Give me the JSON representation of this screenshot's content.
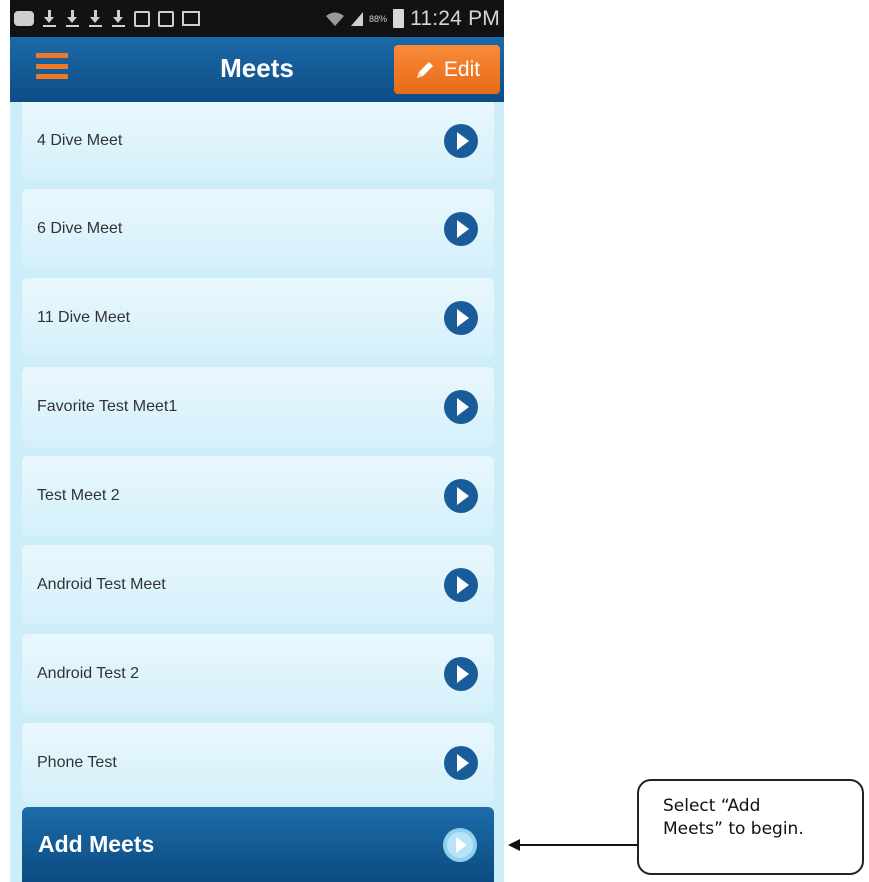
{
  "status_bar": {
    "battery_percent": "88%",
    "time": "11:24 PM"
  },
  "header": {
    "title": "Meets",
    "edit_label": "Edit"
  },
  "meets": [
    {
      "label": "4 Dive Meet"
    },
    {
      "label": "6 Dive Meet"
    },
    {
      "label": "11 Dive Meet"
    },
    {
      "label": "Favorite Test Meet1"
    },
    {
      "label": "Test Meet 2"
    },
    {
      "label": "Android Test Meet"
    },
    {
      "label": "Android Test 2"
    },
    {
      "label": "Phone Test"
    }
  ],
  "add_meets": {
    "label": "Add Meets"
  },
  "callout": {
    "text": "Select “Add\nMeets” to begin."
  },
  "colors": {
    "header_blue": "#0d4d85",
    "accent_orange": "#f07a24",
    "list_bg": "#cdeef8",
    "go_icon_blue": "#1a5c99"
  }
}
